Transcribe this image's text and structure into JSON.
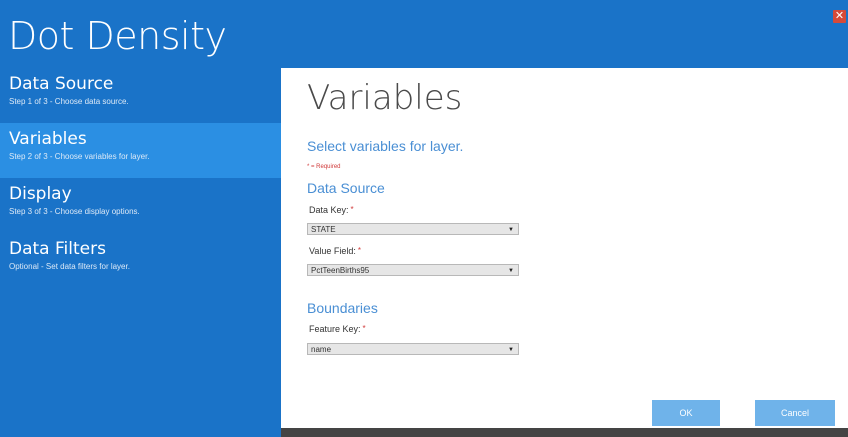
{
  "window": {
    "title": "Dot Density"
  },
  "steps": [
    {
      "name": "Data Source",
      "desc": "Step 1 of 3 - Choose data source."
    },
    {
      "name": "Variables",
      "desc": "Step 2 of 3 - Choose variables for layer."
    },
    {
      "name": "Display",
      "desc": "Step 3 of 3 - Choose display options."
    },
    {
      "name": "Data Filters",
      "desc": "Optional - Set data filters for layer."
    }
  ],
  "main": {
    "heading": "Variables",
    "subheading": "Select variables for layer.",
    "required_note": "* = Required",
    "data_source": {
      "title": "Data Source",
      "data_key_label": "Data Key:",
      "data_key_value": "STATE",
      "value_field_label": "Value Field:",
      "value_field_value": "PctTeenBirths95"
    },
    "boundaries": {
      "title": "Boundaries",
      "feature_key_label": "Feature Key:",
      "feature_key_value": "name"
    }
  },
  "buttons": {
    "ok": "OK",
    "cancel": "Cancel"
  },
  "colors": {
    "accent": "#1a73c8",
    "active_step": "#2b8fe3",
    "button": "#6fb3ea",
    "required": "#d03a3a"
  },
  "icons": {
    "close": "close-icon",
    "dropdown": "chevron-down-icon"
  }
}
